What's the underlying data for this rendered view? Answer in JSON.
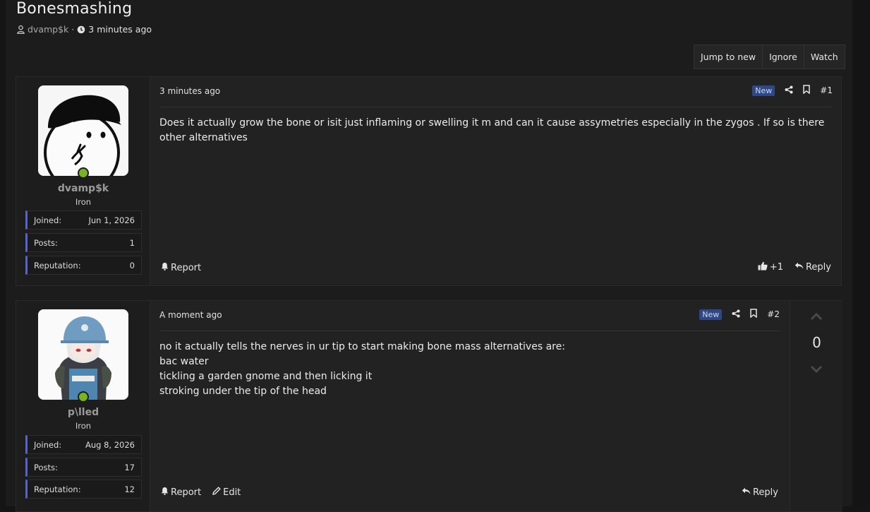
{
  "thread": {
    "title": "Bonesmashing",
    "author": "dvamp$k",
    "time": "3 minutes ago",
    "separator": "·"
  },
  "thread_buttons": {
    "jump": "Jump to new",
    "ignore": "Ignore",
    "watch": "Watch"
  },
  "posts": [
    {
      "username": "dvamp$k",
      "rank": "Iron",
      "stats": [
        {
          "label": "Joined:",
          "value": "Jun 1, 2026"
        },
        {
          "label": "Posts:",
          "value": "1"
        },
        {
          "label": "Reputation:",
          "value": "0"
        }
      ],
      "time": "3 minutes ago",
      "badge": "New",
      "number": "#1",
      "body": [
        "Does it actually grow the bone or isit just inflaming or swelling it m and can it cause assymetries especially in the zygos . If so is there other alternatives"
      ],
      "report": "Report",
      "likes": "+1",
      "reply": "Reply"
    },
    {
      "username": "p\\lled",
      "rank": "Iron",
      "stats": [
        {
          "label": "Joined:",
          "value": "Aug 8, 2026"
        },
        {
          "label": "Posts:",
          "value": "17"
        },
        {
          "label": "Reputation:",
          "value": "12"
        }
      ],
      "time": "A moment ago",
      "badge": "New",
      "number": "#2",
      "body": [
        "no it actually tells the nerves in ur tip to start making bone mass alternatives are:",
        "bac water",
        "tickling a garden gnome and then licking it",
        "stroking under the tip of the head"
      ],
      "report": "Report",
      "edit": "Edit",
      "reply": "Reply",
      "vote_score": "0"
    }
  ],
  "colors": {
    "accent": "#5b63c9",
    "online": "#7bb124",
    "badge_new": "#2e4785"
  }
}
